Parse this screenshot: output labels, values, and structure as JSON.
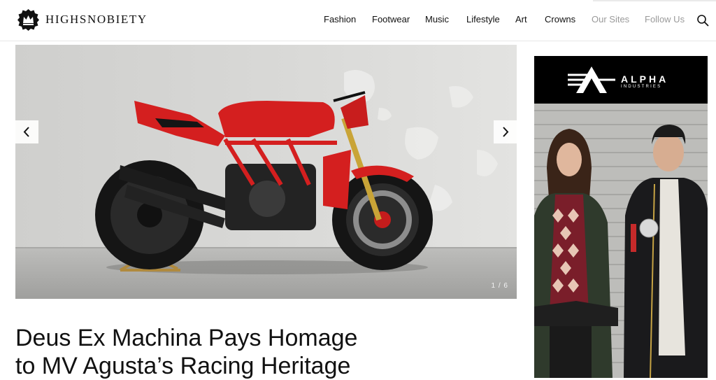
{
  "header": {
    "logo_text": "HIGHSNOBIETY",
    "nav": [
      {
        "label": "Fashion",
        "muted": false
      },
      {
        "label": "Footwear",
        "muted": false
      },
      {
        "label": "Music",
        "muted": false
      },
      {
        "label": "Lifestyle",
        "muted": false
      },
      {
        "label": "Art",
        "muted": false
      },
      {
        "label": "Crowns",
        "muted": false
      },
      {
        "label": "Our Sites",
        "muted": true
      },
      {
        "label": "Follow Us",
        "muted": true
      }
    ],
    "search_icon": "search-icon"
  },
  "hero": {
    "slide_counter": "1 / 6",
    "prev_icon": "chevron-left-icon",
    "next_icon": "chevron-right-icon"
  },
  "article": {
    "headline_line1": "Deus Ex Machina Pays Homage",
    "headline_line2": "to MV Agusta’s Racing Heritage"
  },
  "ad": {
    "brand": "ALPHA",
    "brand_sub": "INDUSTRIES"
  },
  "colors": {
    "bike_red": "#d41f1f",
    "muted_nav": "#9a9a9a",
    "ad_black": "#000000"
  }
}
